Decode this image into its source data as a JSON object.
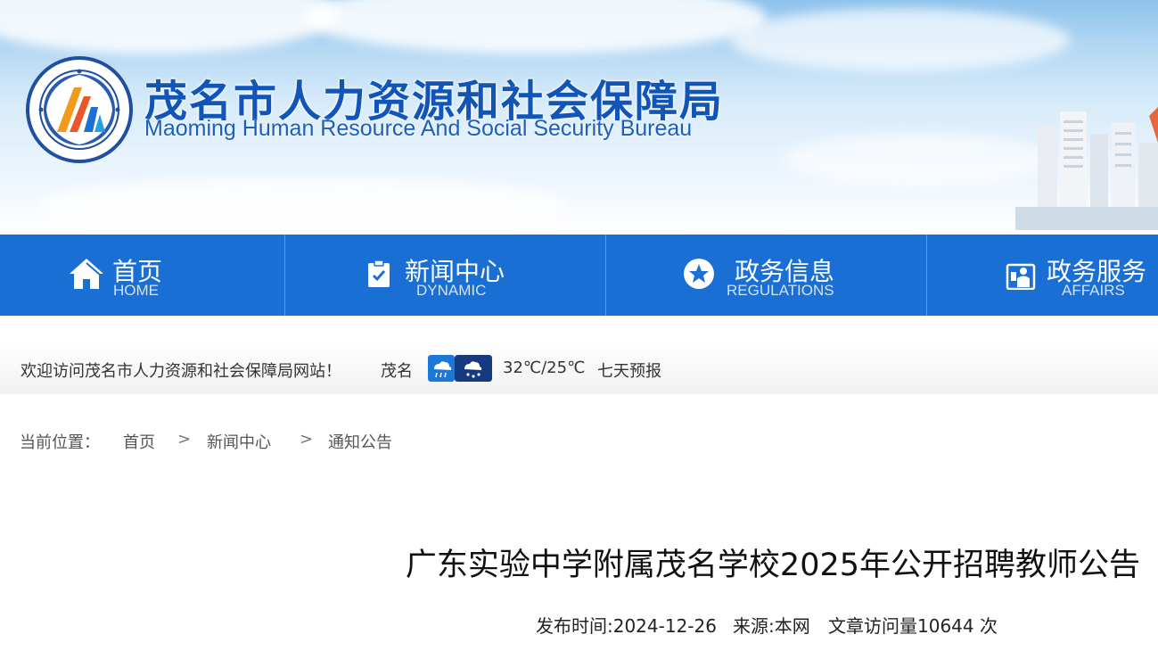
{
  "header": {
    "title_cn": "茂名市人力资源和社会保障局",
    "title_en": "Maoming Human Resource And Social Security Bureau",
    "emblem_icon": "bureau-emblem-icon",
    "brand_color": "#1255b8"
  },
  "nav": {
    "items": [
      {
        "label": "首页",
        "sub": "HOME",
        "icon": "home-icon"
      },
      {
        "label": "新闻中心",
        "sub": "DYNAMIC",
        "icon": "clipboard-check-icon"
      },
      {
        "label": "政务信息",
        "sub": "REGULATIONS",
        "icon": "star-circle-icon"
      },
      {
        "label": "政务服务",
        "sub": "AFFAIRS",
        "icon": "service-person-icon"
      }
    ],
    "bar_color": "#1a6fd4"
  },
  "welcome": {
    "message": "欢迎访问茂名市人力资源和社会保障局网站！",
    "city": "茂名",
    "weather_icons": [
      "rain-cloud-icon",
      "snow-cloud-icon"
    ],
    "temperature": "32℃/25℃",
    "forecast_link": "七天预报"
  },
  "breadcrumb": {
    "prefix": "当前位置：",
    "items": [
      "首页",
      "新闻中心",
      "通知公告"
    ],
    "separator": ">"
  },
  "article": {
    "title": "广东实验中学附属茂名学校2025年公开招聘教师公告",
    "publish": "发布时间:2024-12-26",
    "source": "来源:本网",
    "views": "文章访问量10644 次"
  }
}
